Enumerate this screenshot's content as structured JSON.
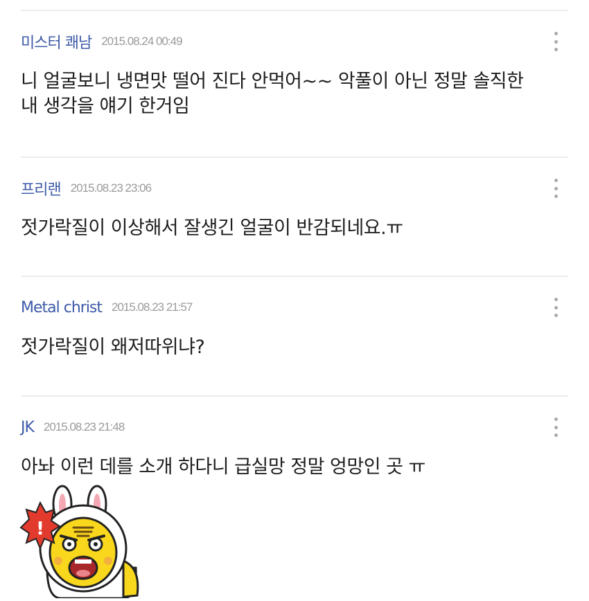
{
  "comments": [
    {
      "author": "미스터 쾌남",
      "date": "2015.08.24 00:49",
      "lines": [
        "니 얼굴보니 냉면맛 떨어 진다 안먹어~~ 악풀이 아닌 정말 솔직한",
        "내 생각을 얘기 한거임"
      ]
    },
    {
      "author": "프리랜",
      "date": "2015.08.23 23:06",
      "lines": [
        "젓가락질이 이상해서 잘생긴 얼굴이 반감되네요.ㅠ"
      ]
    },
    {
      "author": "Metal christ",
      "date": "2015.08.23 21:57",
      "lines": [
        "젓가락질이 왜저따위냐?"
      ]
    },
    {
      "author": "JK",
      "date": "2015.08.23 21:48",
      "lines": [
        "아놔 이런 데를 소개 하다니 급실망 정말 엉망인 곳 ㅠ"
      ]
    }
  ],
  "emoticon": {
    "icon": "shocked-rabbit-hood-character-sticker",
    "exclamation": "!"
  },
  "colors": {
    "author": "#3d5aa8",
    "date": "#9a9a9a",
    "text": "#1d1d1d",
    "divider": "#ececec",
    "sticker_yellow": "#f9d71c",
    "sticker_red": "#e23b2e"
  }
}
